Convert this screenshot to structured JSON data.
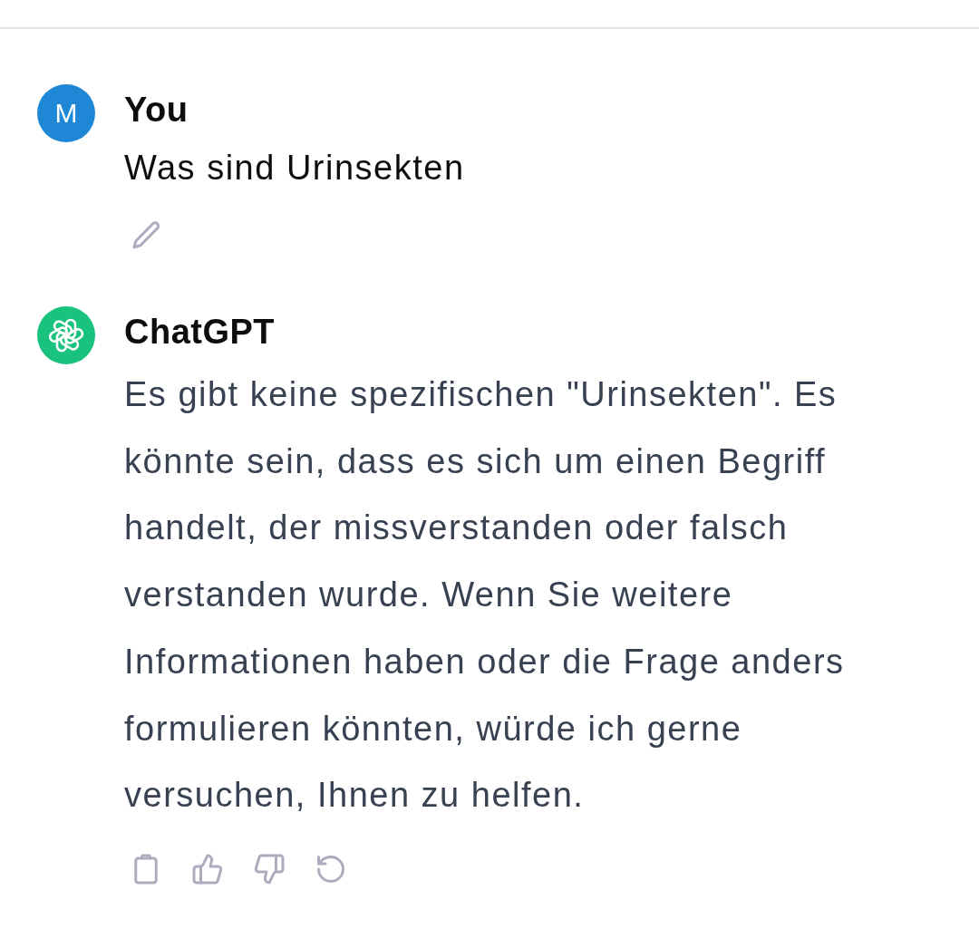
{
  "conversation": {
    "messages": [
      {
        "kind": "user",
        "author": "You",
        "avatar_letter": "M",
        "text": "Was sind Urinsekten"
      },
      {
        "kind": "assistant",
        "author": "ChatGPT",
        "text": "Es gibt keine spezifischen \"Urinsekten\". Es könnte sein, dass es sich um einen Begriff handelt, der missverstanden oder falsch verstanden wurde. Wenn Sie weitere Informationen haben oder die Frage anders formulieren könnten, würde ich gerne versuchen, Ihnen zu helfen."
      }
    ]
  }
}
